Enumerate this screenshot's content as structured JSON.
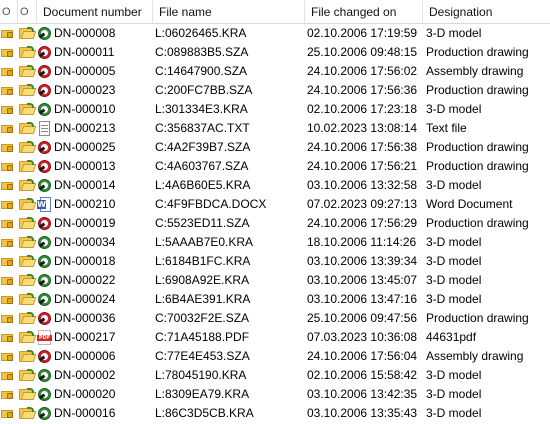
{
  "header": {
    "col_lock": "O",
    "col_folder": "O",
    "doc_number": "Document number",
    "file_name": "File name",
    "changed_on": "File changed on",
    "designation": "Designation"
  },
  "rows": [
    {
      "type": "kra",
      "doc_number": "DN-000008",
      "file_name": "L:06026465.KRA",
      "changed_on": "02.10.2006 17:19:59",
      "designation": "3-D model"
    },
    {
      "type": "sza",
      "doc_number": "DN-000011",
      "file_name": "C:089883B5.SZA",
      "changed_on": "25.10.2006 09:48:15",
      "designation": "Production drawing"
    },
    {
      "type": "sza",
      "doc_number": "DN-000005",
      "file_name": "C:14647900.SZA",
      "changed_on": "24.10.2006 17:56:02",
      "designation": "Assembly drawing"
    },
    {
      "type": "sza",
      "doc_number": "DN-000023",
      "file_name": "C:200FC7BB.SZA",
      "changed_on": "24.10.2006 17:56:36",
      "designation": "Production drawing"
    },
    {
      "type": "kra",
      "doc_number": "DN-000010",
      "file_name": "L:301334E3.KRA",
      "changed_on": "02.10.2006 17:23:18",
      "designation": "3-D model"
    },
    {
      "type": "txt",
      "doc_number": "DN-000213",
      "file_name": "C:356837AC.TXT",
      "changed_on": "10.02.2023 13:08:14",
      "designation": "Text file"
    },
    {
      "type": "sza",
      "doc_number": "DN-000025",
      "file_name": "C:4A2F39B7.SZA",
      "changed_on": "24.10.2006 17:56:38",
      "designation": "Production drawing"
    },
    {
      "type": "sza",
      "doc_number": "DN-000013",
      "file_name": "C:4A603767.SZA",
      "changed_on": "24.10.2006 17:56:21",
      "designation": "Production drawing"
    },
    {
      "type": "kra",
      "doc_number": "DN-000014",
      "file_name": "L:4A6B60E5.KRA",
      "changed_on": "03.10.2006 13:32:58",
      "designation": "3-D model"
    },
    {
      "type": "docx",
      "doc_number": "DN-000210",
      "file_name": "C:4F9FBDCA.DOCX",
      "changed_on": "07.02.2023 09:27:13",
      "designation": "Word Document"
    },
    {
      "type": "sza",
      "doc_number": "DN-000019",
      "file_name": "C:5523ED11.SZA",
      "changed_on": "24.10.2006 17:56:29",
      "designation": "Production drawing"
    },
    {
      "type": "kra",
      "doc_number": "DN-000034",
      "file_name": "L:5AAAB7E0.KRA",
      "changed_on": "18.10.2006 11:14:26",
      "designation": "3-D model"
    },
    {
      "type": "kra",
      "doc_number": "DN-000018",
      "file_name": "L:6184B1FC.KRA",
      "changed_on": "03.10.2006 13:39:34",
      "designation": "3-D model"
    },
    {
      "type": "kra",
      "doc_number": "DN-000022",
      "file_name": "L:6908A92E.KRA",
      "changed_on": "03.10.2006 13:45:07",
      "designation": "3-D model"
    },
    {
      "type": "kra",
      "doc_number": "DN-000024",
      "file_name": "L:6B4AE391.KRA",
      "changed_on": "03.10.2006 13:47:16",
      "designation": "3-D model"
    },
    {
      "type": "sza",
      "doc_number": "DN-000036",
      "file_name": "C:70032F2E.SZA",
      "changed_on": "25.10.2006 09:47:56",
      "designation": "Production drawing"
    },
    {
      "type": "pdf",
      "doc_number": "DN-000217",
      "file_name": "C:71A45188.PDF",
      "changed_on": "07.03.2023 10:36:08",
      "designation": "44631pdf"
    },
    {
      "type": "sza",
      "doc_number": "DN-000006",
      "file_name": "C:77E4E453.SZA",
      "changed_on": "24.10.2006 17:56:04",
      "designation": "Assembly drawing"
    },
    {
      "type": "kra",
      "doc_number": "DN-000002",
      "file_name": "L:78045190.KRA",
      "changed_on": "02.10.2006 15:58:42",
      "designation": "3-D model"
    },
    {
      "type": "kra",
      "doc_number": "DN-000020",
      "file_name": "L:8309EA79.KRA",
      "changed_on": "03.10.2006 13:42:35",
      "designation": "3-D model"
    },
    {
      "type": "kra",
      "doc_number": "DN-000016",
      "file_name": "L:86C3D5CB.KRA",
      "changed_on": "03.10.2006 13:35:43",
      "designation": "3-D model"
    }
  ],
  "icons": {
    "kra": "3d-model-icon",
    "sza": "drawing-icon",
    "txt": "text-file-icon",
    "docx": "word-document-icon",
    "pdf": "pdf-file-icon"
  },
  "colors": {
    "kra": "#2f8f3a",
    "sza": "#d2232a",
    "docx": "#2b5fb4",
    "pdf": "#d7261d",
    "folder": "#f1c84b"
  }
}
